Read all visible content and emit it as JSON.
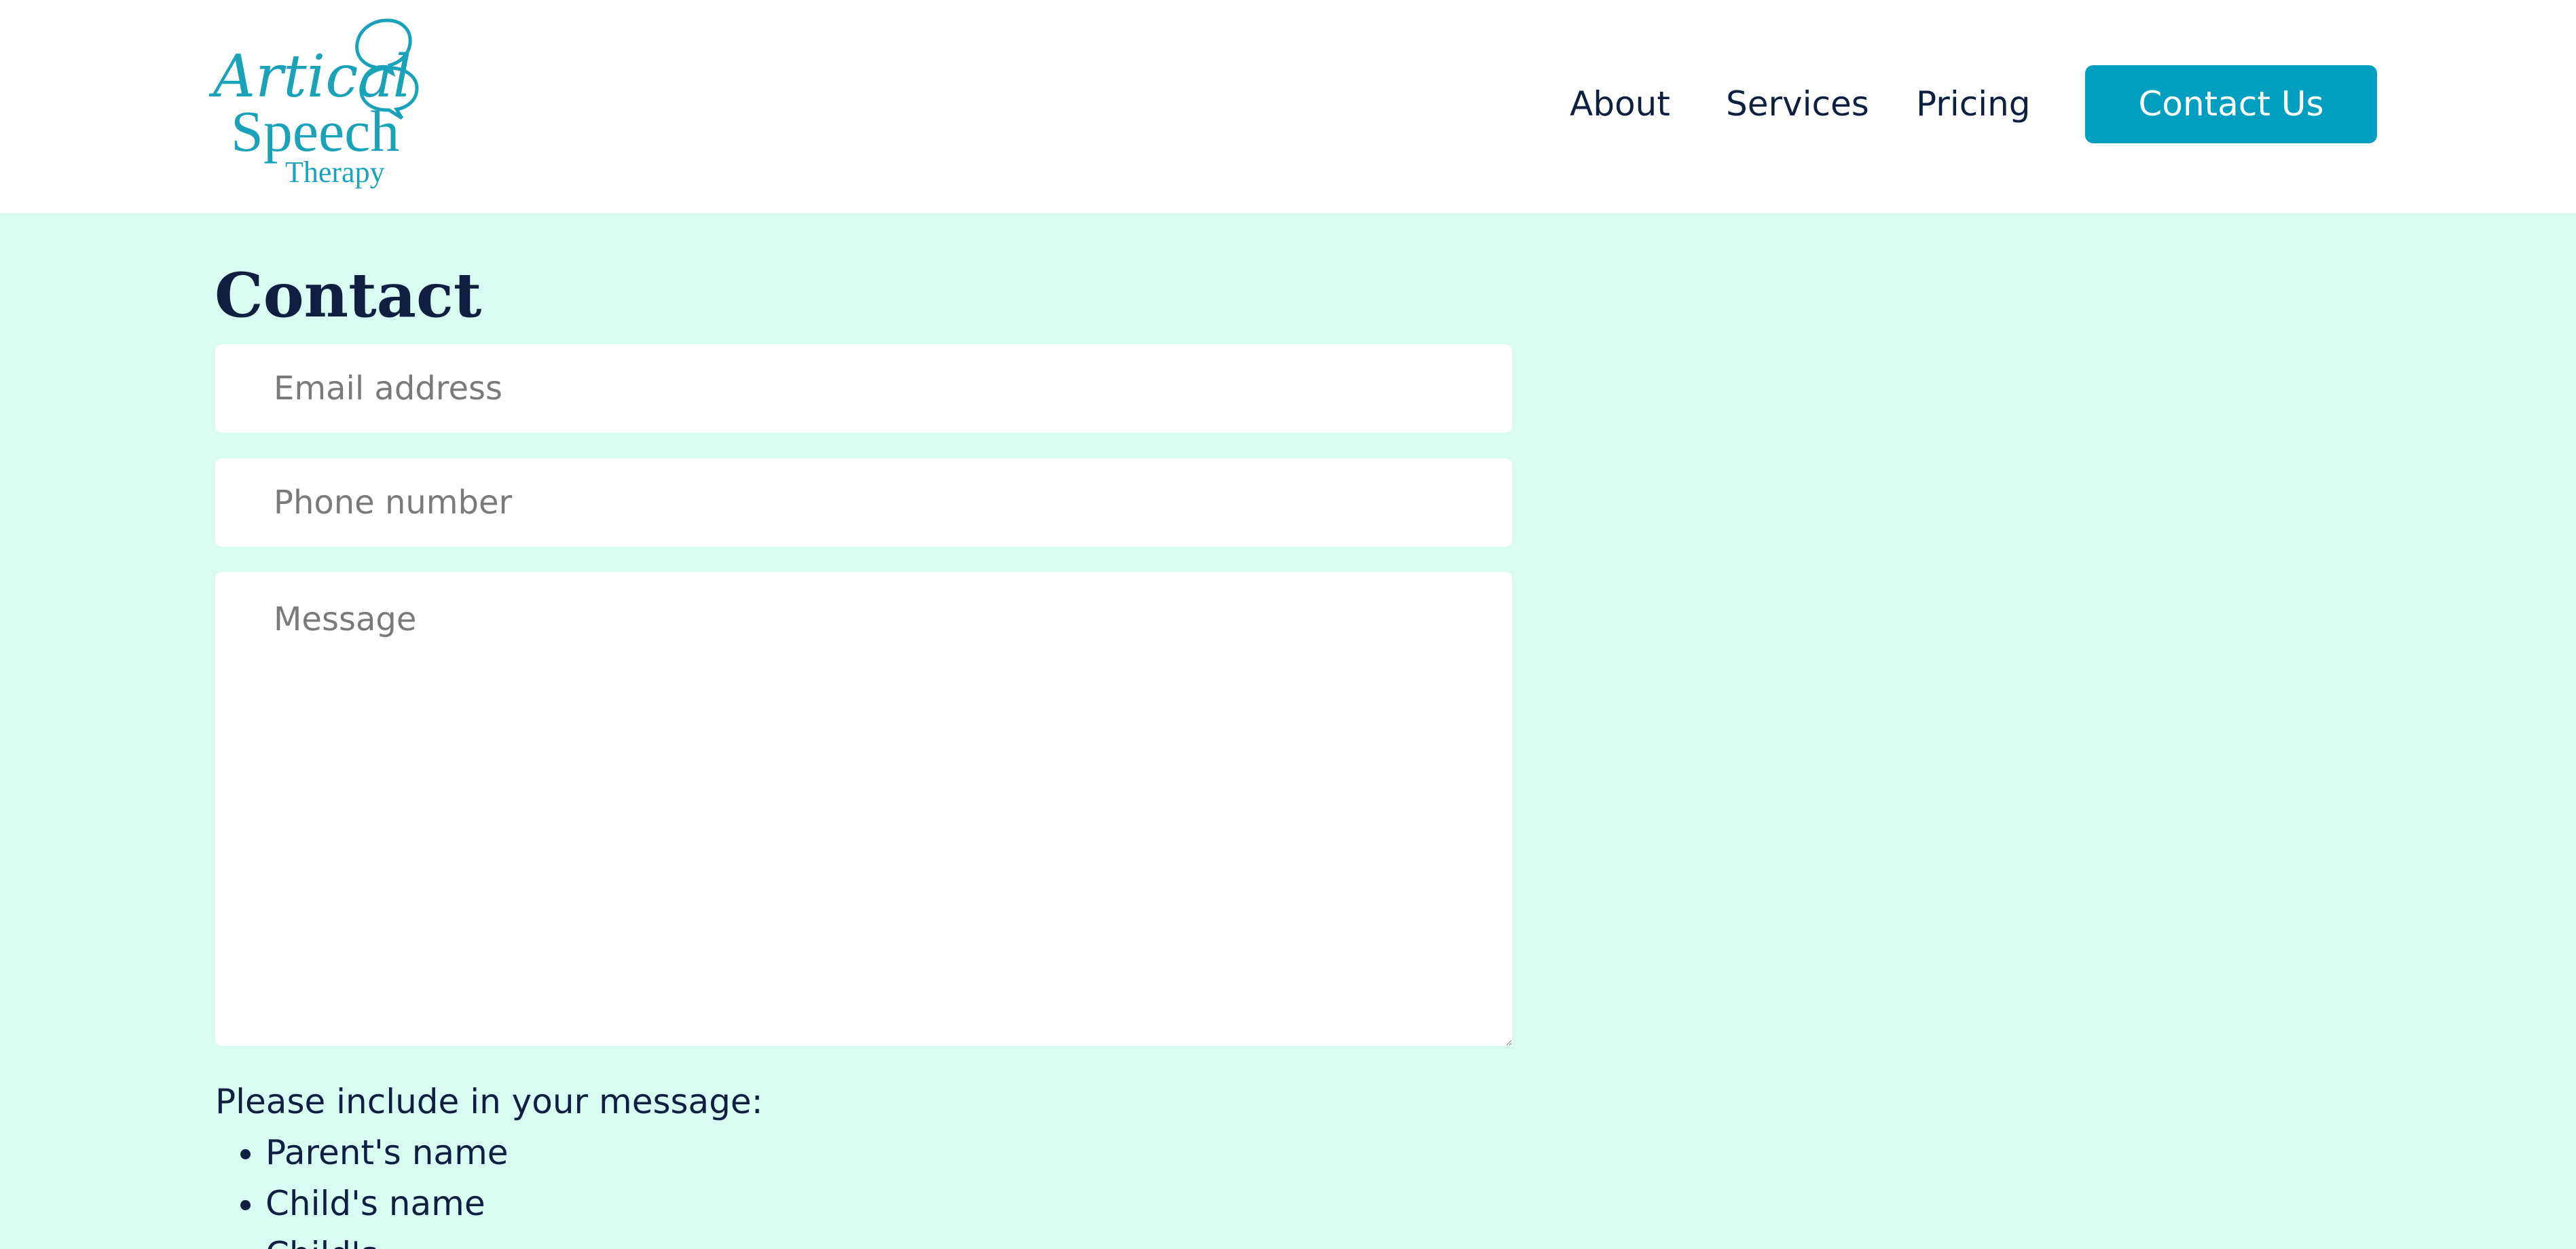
{
  "logo": {
    "line1": "Artical",
    "line2": "Speech",
    "line3": "Therapy",
    "color": "#1aa3b8"
  },
  "nav": {
    "items": [
      {
        "label": "About"
      },
      {
        "label": "Services"
      },
      {
        "label": "Pricing"
      }
    ],
    "cta_label": "Contact Us"
  },
  "contact": {
    "title": "Contact",
    "email_placeholder": "Email address",
    "phone_placeholder": "Phone number",
    "message_placeholder": "Message",
    "instructions_intro": "Please include in your message:",
    "instructions_items": [
      "Parent's name",
      "Child's name",
      "Child's"
    ]
  },
  "colors": {
    "page_background": "#d8fcf2",
    "header_background": "#ffffff",
    "accent": "#009fbf",
    "text": "#0f1f3f"
  }
}
